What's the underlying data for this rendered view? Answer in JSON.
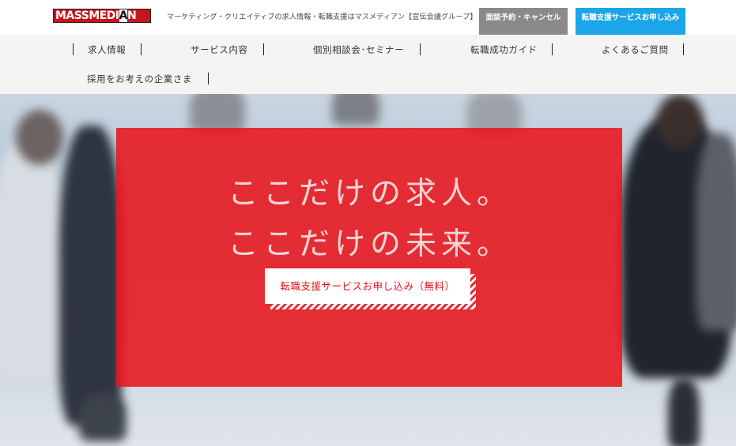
{
  "header": {
    "logo_text": "MASSMEDIAN",
    "tagline": "マーケティング・クリエイティブの求人情報・転職支援はマスメディアン【宣伝会議グループ】",
    "reserve_button": "面談予約・キャンセル",
    "apply_button": "転職支援サービスお申し込み"
  },
  "nav": {
    "items": [
      {
        "label": "求人情報"
      },
      {
        "label": "サービス内容"
      },
      {
        "label": "個別相談会･セミナー"
      },
      {
        "label": "転職成功ガイド"
      },
      {
        "label": "よくあるご質問"
      },
      {
        "label": "採用をお考えの企業さま"
      }
    ]
  },
  "hero": {
    "headline_line1": "ここだけの求人。",
    "headline_line2": "ここだけの未来。",
    "cta_label": "転職支援サービスお申し込み（無料）"
  },
  "colors": {
    "brand_red": "#e8161c",
    "apply_blue": "#1aa6e8",
    "reserve_gray": "#8a8a8a"
  }
}
